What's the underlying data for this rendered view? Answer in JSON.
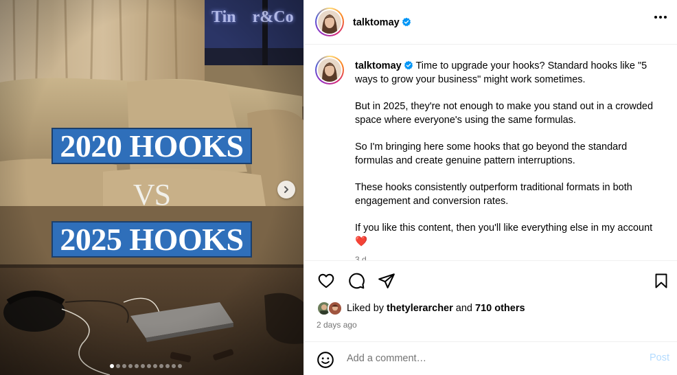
{
  "media": {
    "headline_top": "2020 HOOKS",
    "headline_vs": "VS",
    "headline_bottom": "2025 HOOKS",
    "sign_text": "Tin    r&Co",
    "carousel_total": 12,
    "carousel_current": 1
  },
  "header": {
    "username": "talktomay",
    "verified": true
  },
  "caption": {
    "username": "talktomay",
    "paragraphs": [
      "Time to upgrade your hooks? Standard hooks like \"5 ways to grow your business\" might work sometimes.",
      "But in 2025, they're not enough to make you stand out in a crowded space where everyone's using the same formulas.",
      "So I'm bringing here some hooks that go beyond the standard formulas and create genuine pattern interruptions.",
      "These hooks consistently outperform traditional formats in both engagement and conversion rates.",
      "If you like this content, then you'll like everything else in my account"
    ],
    "heart_emoji": "❤️",
    "age": "3 d"
  },
  "engagement": {
    "liked_by_prefix": "Liked by ",
    "liked_by_user": "thetylerarcher",
    "and_word": " and ",
    "others": "710 others",
    "time_ago": "2 days ago"
  },
  "comment": {
    "placeholder": "Add a comment…",
    "post_label": "Post"
  },
  "colors": {
    "verified_blue": "#0095f6",
    "hook_box_blue": "#2f6fba",
    "post_disabled": "#b3dbff",
    "heart_red": "#ed1c24"
  }
}
